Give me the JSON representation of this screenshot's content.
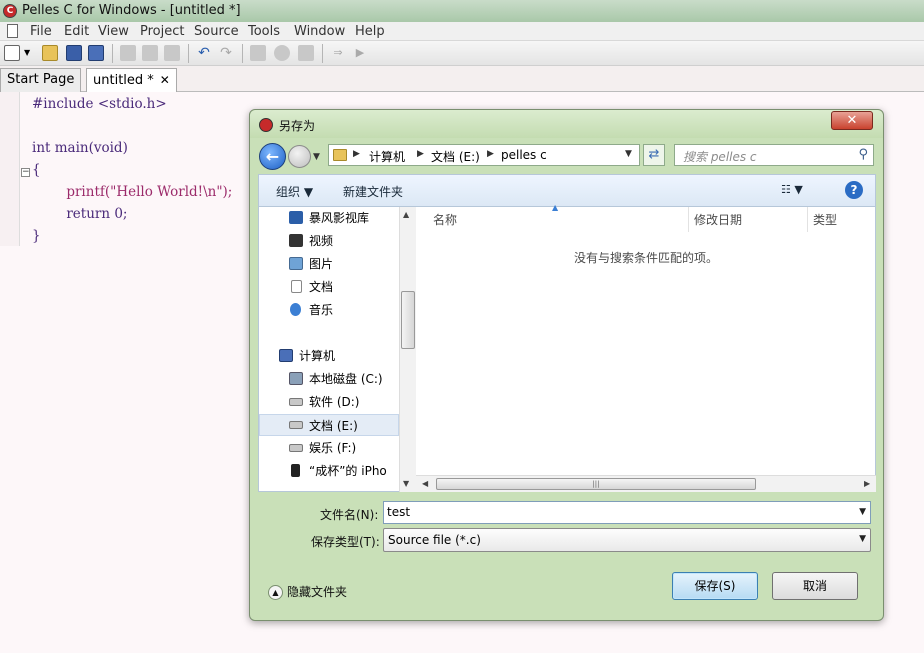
{
  "window": {
    "title": "Pelles C for Windows - [untitled *]"
  },
  "menu": [
    "File",
    "Edit",
    "View",
    "Project",
    "Source",
    "Tools",
    "Window",
    "Help"
  ],
  "tabs": [
    {
      "label": "Start Page"
    },
    {
      "label": "untitled *",
      "close": "✕"
    }
  ],
  "editor": {
    "lines": [
      "#include <stdio.h>",
      "",
      "int main(void)",
      "{",
      "        printf(\"Hello World!\\n\");",
      "        return 0;",
      "}"
    ]
  },
  "dialog": {
    "title": "另存为",
    "close": "✕",
    "address": {
      "crumbs": [
        "计算机",
        "文档 (E:)",
        "pelles c"
      ]
    },
    "search_placeholder": "搜索 pelles c",
    "commands": {
      "organize": "组织",
      "new_folder": "新建文件夹",
      "help": "?"
    },
    "nav_items": [
      {
        "label": "暴风影视库"
      },
      {
        "label": "视频"
      },
      {
        "label": "图片"
      },
      {
        "label": "文档"
      },
      {
        "label": "音乐"
      },
      {
        "label": "计算机"
      },
      {
        "label": "本地磁盘 (C:)"
      },
      {
        "label": "软件 (D:)"
      },
      {
        "label": "文档 (E:)"
      },
      {
        "label": "娱乐 (F:)"
      },
      {
        "label": "“成杯”的 iPho"
      }
    ],
    "columns": [
      "名称",
      "修改日期",
      "类型"
    ],
    "empty_message": "没有与搜索条件匹配的项。",
    "filename_label": "文件名(N):",
    "filename_value": "test",
    "filetype_label": "保存类型(T):",
    "filetype_value": "Source file (*.c)",
    "hide_folders": "隐藏文件夹",
    "save_button": "保存(S)",
    "cancel_button": "取消"
  },
  "colors": {
    "dialog_frame": "#c9e0b8",
    "save_accent": "#3c7fb1",
    "keyword": "#4a2a7a",
    "string": "#9b2a6a"
  }
}
